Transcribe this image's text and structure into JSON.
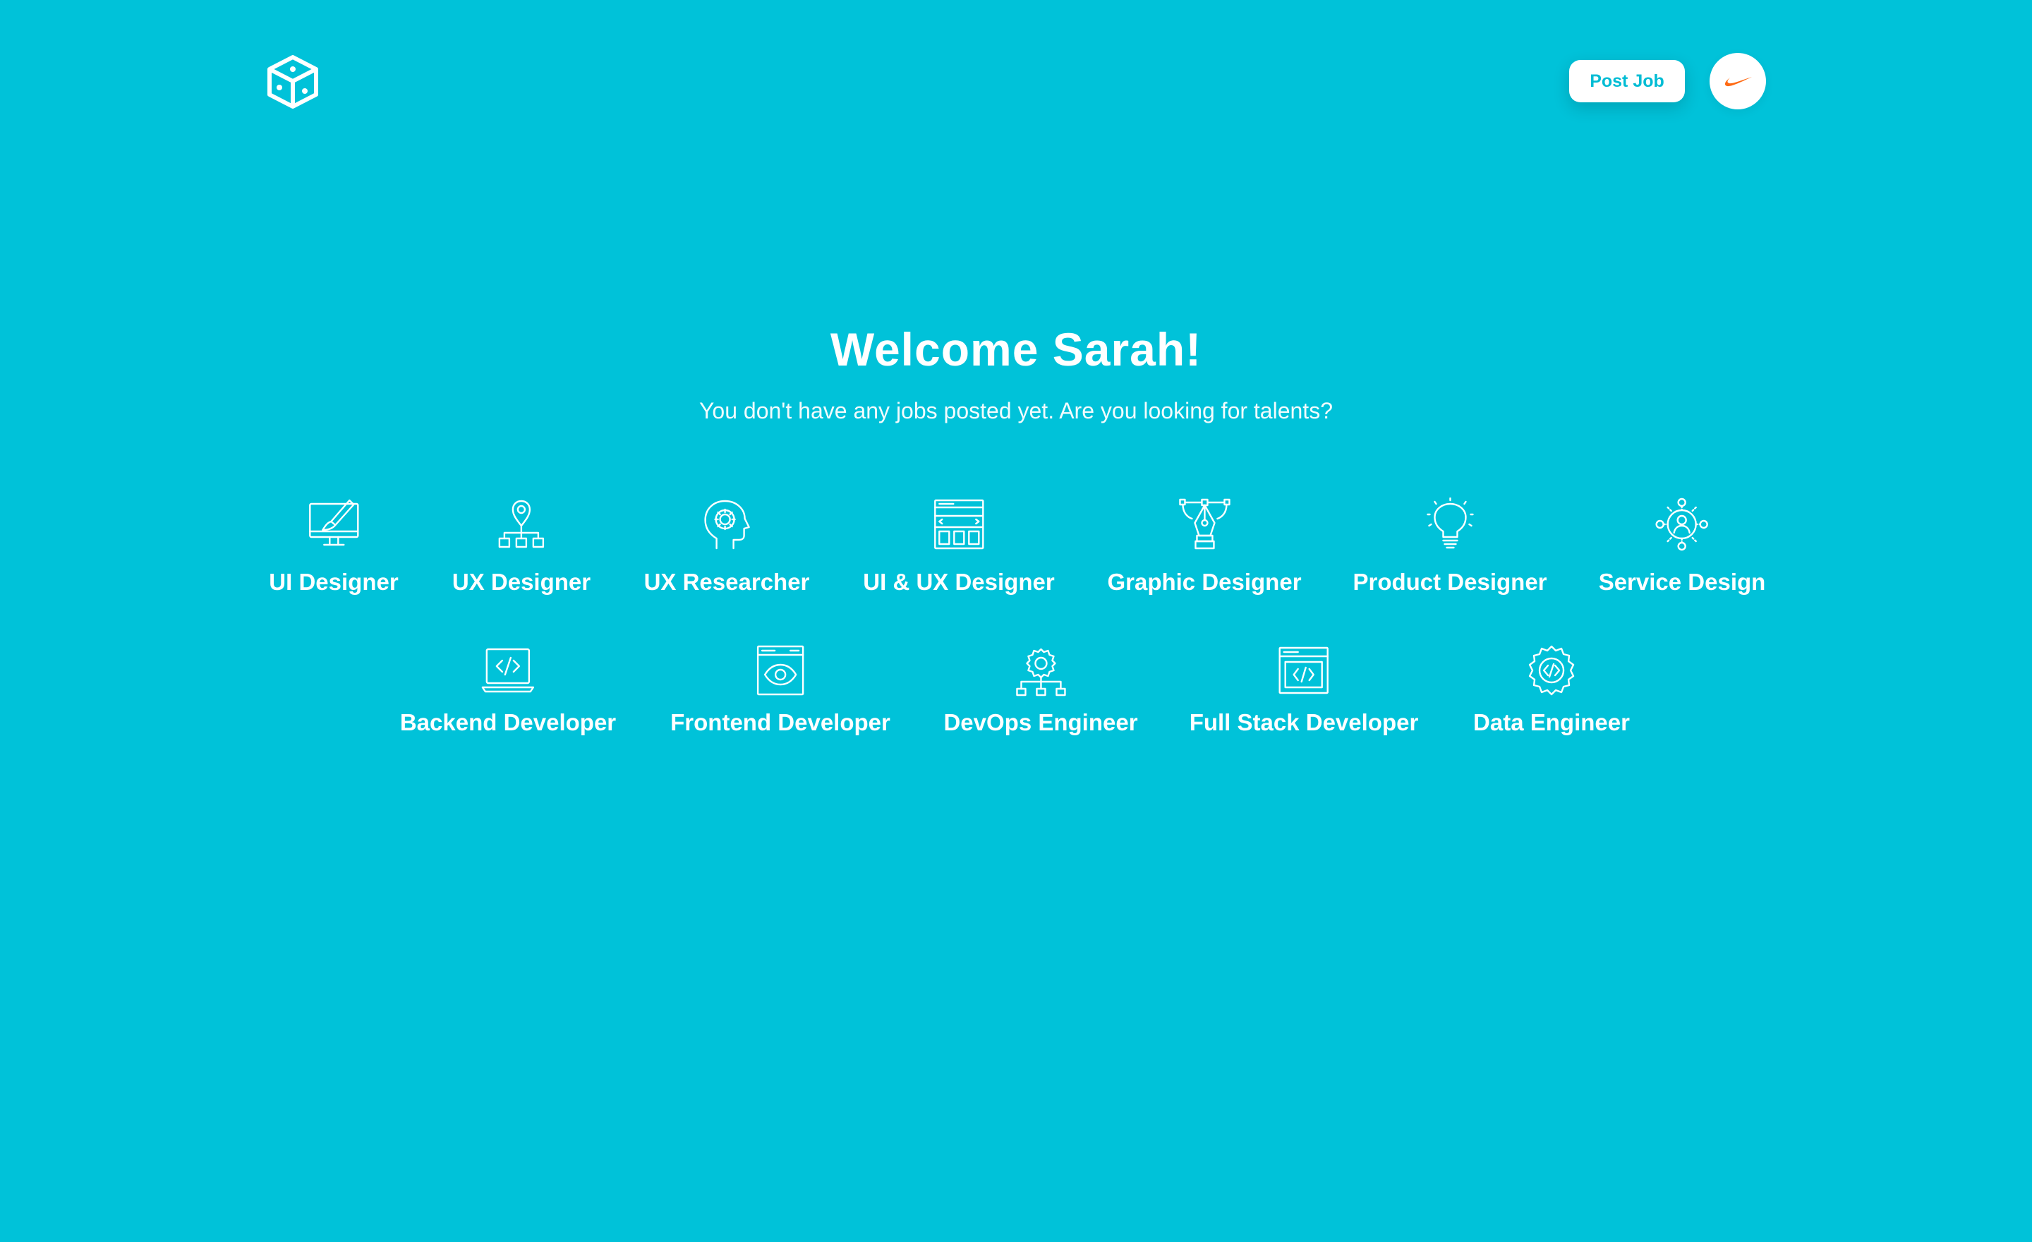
{
  "header": {
    "logo_icon": "cube-logo-icon",
    "post_job_label": "Post Job",
    "avatar_icon": "swoosh-logo-icon",
    "avatar_color": "#FF6A13"
  },
  "hero": {
    "title": "Welcome Sarah!",
    "subtitle": "You don't have any jobs posted yet. Are you looking for talents?"
  },
  "categories": {
    "row1": [
      {
        "label": "UI Designer",
        "icon": "monitor-brush-icon"
      },
      {
        "label": "UX Designer",
        "icon": "sitemap-pin-icon"
      },
      {
        "label": "UX Researcher",
        "icon": "head-gear-icon"
      },
      {
        "label": "UI & UX Designer",
        "icon": "wireframe-browser-icon"
      },
      {
        "label": "Graphic Designer",
        "icon": "pen-tool-icon"
      },
      {
        "label": "Product Designer",
        "icon": "lightbulb-icon"
      },
      {
        "label": "Service Design",
        "icon": "user-network-icon"
      }
    ],
    "row2": [
      {
        "label": "Backend Developer",
        "icon": "laptop-code-icon"
      },
      {
        "label": "Frontend Developer",
        "icon": "browser-eye-icon"
      },
      {
        "label": "DevOps Engineer",
        "icon": "gear-network-icon"
      },
      {
        "label": "Full Stack Developer",
        "icon": "browser-code-icon"
      },
      {
        "label": "Data Engineer",
        "icon": "gear-code-icon"
      }
    ]
  },
  "colors": {
    "background": "#00C2D9",
    "text": "#FFFFFF",
    "button_text": "#00BCD4"
  }
}
